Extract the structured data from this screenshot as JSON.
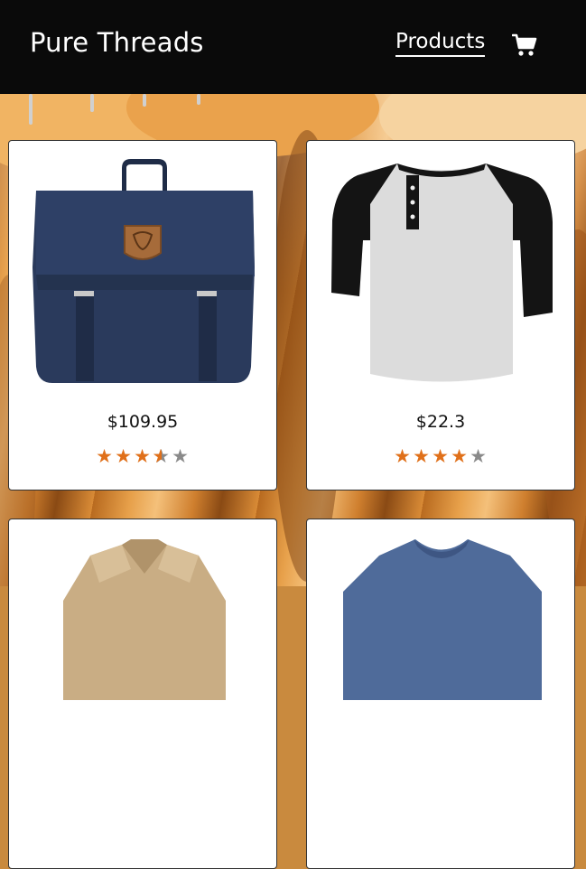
{
  "brand": "Pure Threads",
  "nav": {
    "products_label": "Products"
  },
  "icons": {
    "cart": "cart-icon",
    "star": "star-icon"
  },
  "colors": {
    "header_bg": "#0a0a0a",
    "star_filled": "#e0701a",
    "star_empty": "#8a8a8a"
  },
  "products": [
    {
      "name": "backpack",
      "price": "$109.95",
      "rating": 3.5
    },
    {
      "name": "henley-shirt",
      "price": "$22.3",
      "rating": 4
    },
    {
      "name": "jacket",
      "price": "",
      "rating": null
    },
    {
      "name": "t-shirt",
      "price": "",
      "rating": null
    }
  ]
}
